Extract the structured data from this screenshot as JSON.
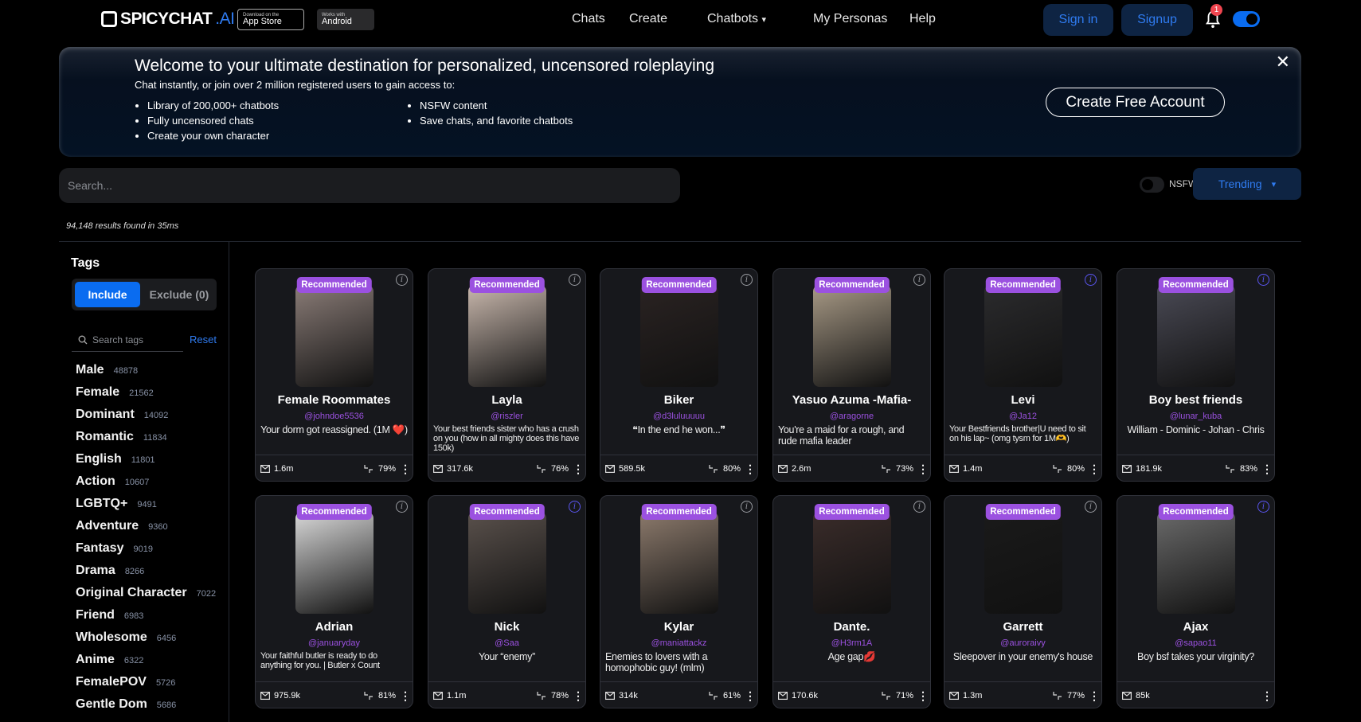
{
  "nav": {
    "logo": "SPICYCHAT",
    "logo_suffix": ".AI",
    "appstore_small": "Download on the",
    "appstore": "App Store",
    "android_small": "Works with",
    "android": "Android",
    "links": [
      "Chats",
      "Create",
      "Chatbots",
      "My Personas",
      "Help"
    ],
    "chatbots_caret": "▾",
    "signin": "Sign in",
    "signup": "Signup",
    "notif_count": "1"
  },
  "banner": {
    "title": "Welcome to your ultimate destination for personalized, uncensored roleplaying",
    "subtitle": "Chat instantly, or join over 2 million registered users to gain access to:",
    "list_left": [
      "Library of 200,000+ chatbots",
      "Fully uncensored chats",
      "Create your own character"
    ],
    "list_right": [
      "NSFW content",
      "Save chats, and favorite chatbots"
    ],
    "cta": "Create Free Account",
    "close": "✕"
  },
  "search": {
    "placeholder": "Search...",
    "value": ""
  },
  "filters": {
    "nsfw_label": "NSFW",
    "nsfw_on": false,
    "sort": "Trending",
    "sort_caret": "▾"
  },
  "results_text": "94,148 results found in 35ms",
  "sidebar": {
    "heading": "Tags",
    "include": "Include",
    "exclude": "Exclude (0)",
    "search_placeholder": "Search tags",
    "reset": "Reset",
    "tags": [
      {
        "name": "Male",
        "count": "48878"
      },
      {
        "name": "Female",
        "count": "21562"
      },
      {
        "name": "Dominant",
        "count": "14092"
      },
      {
        "name": "Romantic",
        "count": "11834"
      },
      {
        "name": "English",
        "count": "11801"
      },
      {
        "name": "Action",
        "count": "10607"
      },
      {
        "name": "LGBTQ+",
        "count": "9491"
      },
      {
        "name": "Adventure",
        "count": "9360"
      },
      {
        "name": "Fantasy",
        "count": "9019"
      },
      {
        "name": "Drama",
        "count": "8266"
      },
      {
        "name": "Original Character",
        "count": "7022"
      },
      {
        "name": "Friend",
        "count": "6983"
      },
      {
        "name": "Wholesome",
        "count": "6456"
      },
      {
        "name": "Anime",
        "count": "6322"
      },
      {
        "name": "FemalePOV",
        "count": "5726"
      },
      {
        "name": "Gentle Dom",
        "count": "5686"
      }
    ]
  },
  "card_badge": "Recommended",
  "cards": [
    {
      "name": "Female Roommates",
      "handle": "@johndoe5536",
      "desc": "Your dorm got reassigned. (1M ❤️)",
      "chats": "1.6m",
      "rating": "79%",
      "info_active": false,
      "img": "#8a7c77"
    },
    {
      "name": "Layla",
      "handle": "@riszler",
      "desc": "Your best friends sister who has a crush on you (how in all mighty does this have 150k)",
      "chats": "317.6k",
      "rating": "76%",
      "info_active": false,
      "img": "#c9b8ad"
    },
    {
      "name": "Biker",
      "handle": "@d3luluuuuu",
      "desc": "❝In the end he won...❞",
      "chats": "589.5k",
      "rating": "80%",
      "info_active": false,
      "img": "#2a2322"
    },
    {
      "name": "Yasuo Azuma -Mafia-",
      "handle": "@aragorne",
      "desc": "You're a maid for a rough, and rude mafia leader",
      "chats": "2.6m",
      "rating": "73%",
      "info_active": false,
      "img": "#a89a86"
    },
    {
      "name": "Levi",
      "handle": "@Ja12",
      "desc": "Your Bestfriends brother|U need to sit on his lap~ (omg tysm for 1M🫶)",
      "chats": "1.4m",
      "rating": "80%",
      "info_active": true,
      "img": "#2b2b2d"
    },
    {
      "name": "Boy best friends",
      "handle": "@lunar_kuba",
      "desc": "William - Dominic - Johan - Chris",
      "chats": "181.9k",
      "rating": "83%",
      "info_active": true,
      "img": "#4a4a55"
    },
    {
      "name": "Adrian",
      "handle": "@januaryday",
      "desc": "Your faithful butler is ready to do anything for you. | Butler x Count",
      "chats": "975.9k",
      "rating": "81%",
      "info_active": false,
      "img": "#d9d9d9"
    },
    {
      "name": "Nick",
      "handle": "@Saa",
      "desc": "Your “enemy”",
      "chats": "1.1m",
      "rating": "78%",
      "info_active": true,
      "img": "#5a514c"
    },
    {
      "name": "Kylar",
      "handle": "@maniattackz",
      "desc": "Enemies to lovers with a homophobic guy! (mlm)",
      "chats": "314k",
      "rating": "61%",
      "info_active": false,
      "img": "#8c7a6c"
    },
    {
      "name": "Dante.",
      "handle": "@H3rm1A",
      "desc": "Age gap💋",
      "chats": "170.6k",
      "rating": "71%",
      "info_active": false,
      "img": "#3a2c2a"
    },
    {
      "name": "Garrett",
      "handle": "@auroraivy",
      "desc": "Sleepover in your enemy's house",
      "chats": "1.3m",
      "rating": "77%",
      "info_active": false,
      "img": "#1a1a1a"
    },
    {
      "name": "Ajax",
      "handle": "@sapao11",
      "desc": "Boy bsf takes your virginity?",
      "chats": "85k",
      "rating": null,
      "info_active": true,
      "img": "#6a6a6a"
    }
  ]
}
